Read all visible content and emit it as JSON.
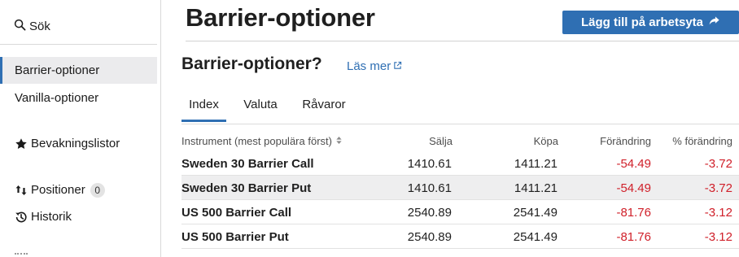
{
  "sidebar": {
    "search_label": "Sök",
    "items": [
      {
        "label": "Barrier-optioner",
        "active": true
      },
      {
        "label": "Vanilla-optioner",
        "active": false
      },
      {
        "label": "Bevakningslistor",
        "icon": "star-icon"
      },
      {
        "label": "Positioner",
        "icon": "sort-arrows-icon",
        "badge": "0"
      },
      {
        "label": "Historik",
        "icon": "history-icon"
      }
    ]
  },
  "header": {
    "title": "Barrier-optioner",
    "add_button_label": "Lägg till på arbetsyta"
  },
  "section": {
    "title": "Barrier-optioner?",
    "read_more_label": "Läs mer"
  },
  "tabs": [
    {
      "label": "Index",
      "active": true
    },
    {
      "label": "Valuta",
      "active": false
    },
    {
      "label": "Råvaror",
      "active": false
    }
  ],
  "table": {
    "columns": [
      "Instrument (mest populära först)",
      "Sälja",
      "Köpa",
      "Förändring",
      "% förändring"
    ],
    "rows": [
      {
        "name": "Sweden 30 Barrier Call",
        "sell": "1410.61",
        "buy": "1411.21",
        "change": "-54.49",
        "pct": "-3.72"
      },
      {
        "name": "Sweden 30 Barrier Put",
        "sell": "1410.61",
        "buy": "1411.21",
        "change": "-54.49",
        "pct": "-3.72"
      },
      {
        "name": "US 500 Barrier Call",
        "sell": "2540.89",
        "buy": "2541.49",
        "change": "-81.76",
        "pct": "-3.12"
      },
      {
        "name": "US 500 Barrier Put",
        "sell": "2540.89",
        "buy": "2541.49",
        "change": "-81.76",
        "pct": "-3.12"
      }
    ]
  },
  "colors": {
    "accent": "#2f6fb3",
    "negative": "#d0202a",
    "hover_row": "#eeeeef"
  }
}
